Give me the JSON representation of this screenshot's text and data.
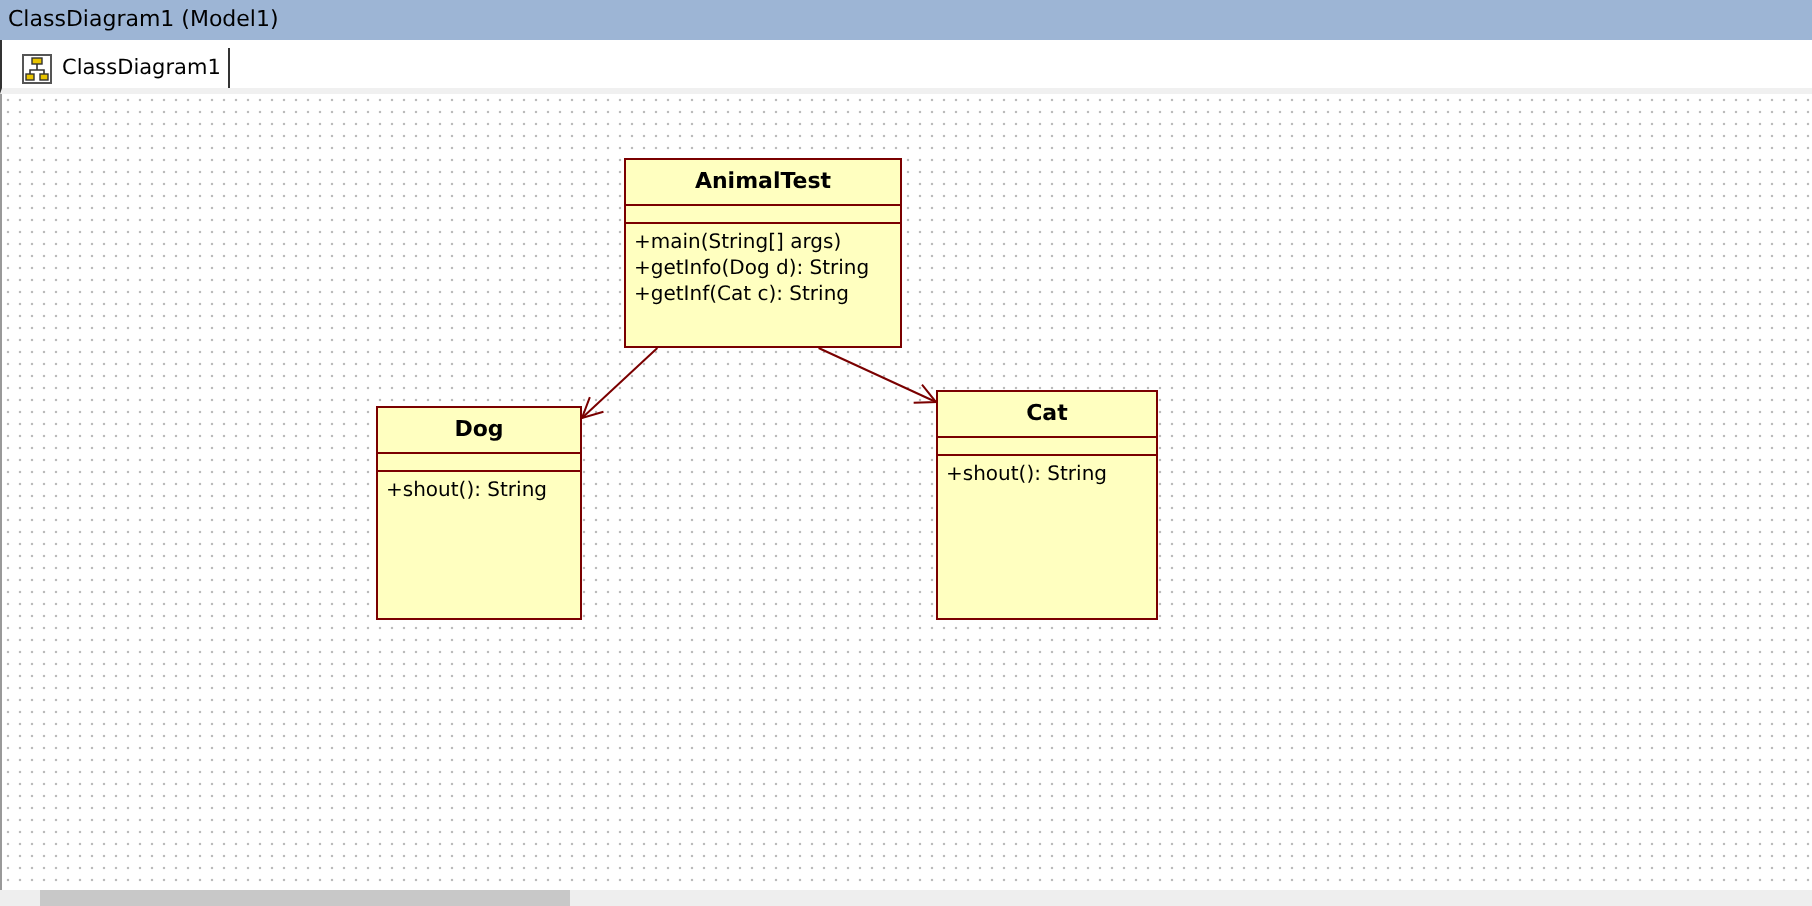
{
  "window": {
    "title": "ClassDiagram1 (Model1)"
  },
  "tabs": [
    {
      "label": "ClassDiagram1",
      "selected": true
    }
  ],
  "diagram": {
    "classes": [
      {
        "name": "AnimalTest",
        "operations": [
          "+main(String[] args)",
          "+getInfo(Dog d): String",
          "+getInf(Cat c): String"
        ]
      },
      {
        "name": "Dog",
        "operations": [
          "+shout(): String"
        ]
      },
      {
        "name": "Cat",
        "operations": [
          "+shout(): String"
        ]
      }
    ]
  }
}
